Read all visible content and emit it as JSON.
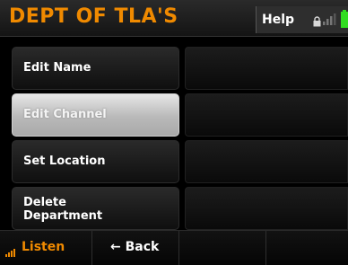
{
  "header": {
    "title": "DEPT OF TLA'S",
    "help_label": "Help",
    "status_icons": [
      "lock-icon",
      "signal-icon",
      "battery-icon"
    ],
    "accent_color": "#f08a00",
    "battery_color": "#33dd22"
  },
  "menu": {
    "items": [
      {
        "label": "Edit Name",
        "value": ""
      },
      {
        "label": "Edit Channel",
        "value": "",
        "selected": true
      },
      {
        "label": "Set Location",
        "value": ""
      },
      {
        "label": "Delete Department",
        "value": ""
      }
    ]
  },
  "footer": {
    "listen_label": "Listen",
    "back_label": "← Back"
  }
}
